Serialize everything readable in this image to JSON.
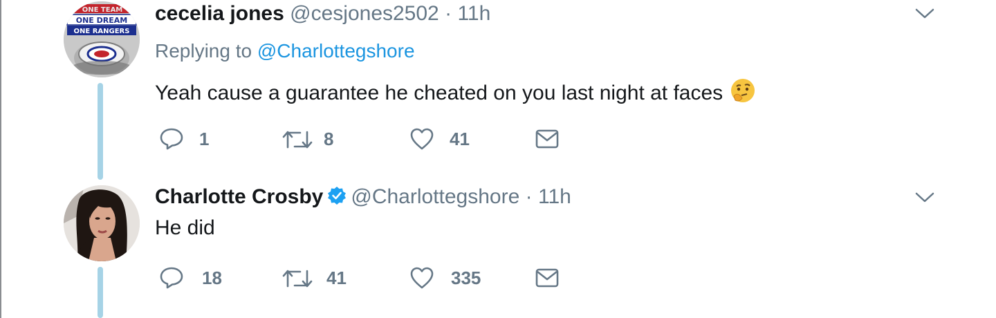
{
  "tweets": [
    {
      "name": "cecelia jones",
      "handle": "@cesjones2502",
      "separator": "·",
      "time": "11h",
      "replying_prefix": "Replying to",
      "replying_to": "@Charlottegshore",
      "text": "Yeah cause a guarantee he cheated on you last night at faces",
      "avatar_text": [
        "ONE TEAM",
        "ONE DREAM",
        "ONE RANGERS"
      ],
      "actions": {
        "replies": "1",
        "retweets": "8",
        "likes": "41"
      }
    },
    {
      "name": "Charlotte Crosby",
      "handle": "@Charlottegshore",
      "separator": "·",
      "time": "11h",
      "text": "He did",
      "verified": true,
      "actions": {
        "replies": "18",
        "retweets": "41",
        "likes": "335"
      }
    }
  ],
  "icons": {
    "reply": "reply-icon",
    "retweet": "retweet-icon",
    "like": "heart-icon",
    "dm": "envelope-icon",
    "caret": "chevron-down-icon",
    "verified": "verified-badge-icon",
    "emoji": "thinking-face-emoji"
  },
  "colors": {
    "text": "#14171a",
    "muted": "#657786",
    "link": "#1b95e0",
    "thread_line": "#a6d3e6",
    "verified": "#1da1f2"
  }
}
